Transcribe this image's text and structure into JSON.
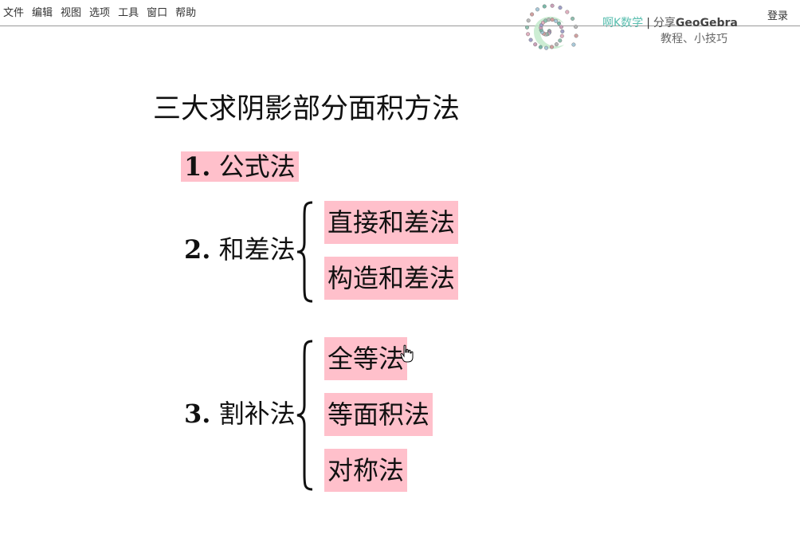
{
  "menu": {
    "items": [
      "文件",
      "编辑",
      "视图",
      "选项",
      "工具",
      "窗口",
      "帮助"
    ],
    "login": "登录"
  },
  "brand": {
    "prefix": "啊K数学",
    "separator": "|",
    "share": "分享",
    "product": "GeoGebra",
    "subtitle": "教程、小技巧"
  },
  "content": {
    "title": "三大求阴影部分面积方法",
    "method1": {
      "number": "1.",
      "name": "公式法"
    },
    "method2": {
      "number": "2.",
      "name": "和差法",
      "subs": [
        "直接和差法",
        "构造和差法"
      ]
    },
    "method3": {
      "number": "3.",
      "name": "割补法",
      "subs": [
        "全等法",
        "等面积法",
        "对称法"
      ]
    }
  },
  "colors": {
    "highlight": "#ffc0cb",
    "brand_teal": "#5bbfb0"
  }
}
